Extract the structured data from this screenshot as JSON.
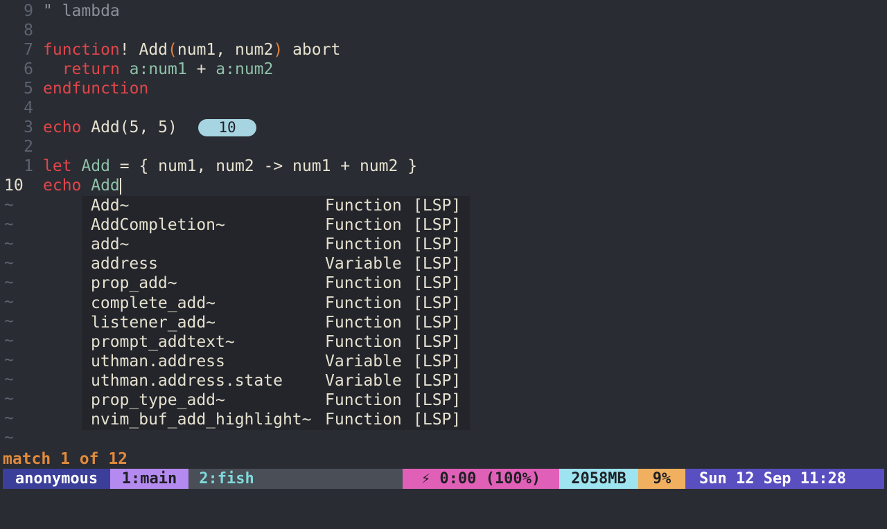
{
  "editor": {
    "lines": [
      {
        "num": "9",
        "tokens": [
          {
            "t": "\" lambda",
            "c": "comment"
          }
        ]
      },
      {
        "num": "8",
        "tokens": []
      },
      {
        "num": "7",
        "tokens": [
          {
            "t": "function",
            "c": "kw"
          },
          {
            "t": "! Add",
            "c": "ident"
          },
          {
            "t": "(",
            "c": "paren"
          },
          {
            "t": "num1, num2",
            "c": "ident"
          },
          {
            "t": ")",
            "c": "paren"
          },
          {
            "t": " abort",
            "c": "ident"
          }
        ]
      },
      {
        "num": "6",
        "tokens": [
          {
            "t": "  ",
            "c": "ident"
          },
          {
            "t": "return",
            "c": "kw"
          },
          {
            "t": " a:num1",
            "c": "var"
          },
          {
            "t": " + ",
            "c": "ident"
          },
          {
            "t": "a:num2",
            "c": "var"
          }
        ]
      },
      {
        "num": "5",
        "tokens": [
          {
            "t": "endfunction",
            "c": "kw"
          }
        ]
      },
      {
        "num": "4",
        "tokens": []
      },
      {
        "num": "3",
        "tokens": [
          {
            "t": "echo",
            "c": "kw"
          },
          {
            "t": " Add(5, 5)",
            "c": "ident"
          }
        ]
      },
      {
        "num": "2",
        "tokens": []
      },
      {
        "num": "1",
        "tokens": [
          {
            "t": "let",
            "c": "kw"
          },
          {
            "t": " Add",
            "c": "var"
          },
          {
            "t": " = { num1, num2 -> num1 + num2 }",
            "c": "ident"
          }
        ]
      },
      {
        "num": "10",
        "tokens": [
          {
            "t": "echo",
            "c": "kw"
          },
          {
            "t": " Add",
            "c": "var"
          }
        ],
        "current": true
      }
    ],
    "virtual_text": "10",
    "tilde": "~"
  },
  "completion": {
    "items": [
      {
        "word": "Add~",
        "kind": "Function",
        "menu": "[LSP]"
      },
      {
        "word": "AddCompletion~",
        "kind": "Function",
        "menu": "[LSP]"
      },
      {
        "word": "add~",
        "kind": "Function",
        "menu": "[LSP]"
      },
      {
        "word": "address",
        "kind": "Variable",
        "menu": "[LSP]"
      },
      {
        "word": "prop_add~",
        "kind": "Function",
        "menu": "[LSP]"
      },
      {
        "word": "complete_add~",
        "kind": "Function",
        "menu": "[LSP]"
      },
      {
        "word": "listener_add~",
        "kind": "Function",
        "menu": "[LSP]"
      },
      {
        "word": "prompt_addtext~",
        "kind": "Function",
        "menu": "[LSP]"
      },
      {
        "word": "uthman.address",
        "kind": "Variable",
        "menu": "[LSP]"
      },
      {
        "word": "uthman.address.state",
        "kind": "Variable",
        "menu": "[LSP]"
      },
      {
        "word": "prop_type_add~",
        "kind": "Function",
        "menu": "[LSP]"
      },
      {
        "word": "nvim_buf_add_highlight~",
        "kind": "Function",
        "menu": "[LSP]"
      }
    ]
  },
  "cmdline": "match 1 of 12",
  "tmux": {
    "session": "anonymous",
    "windows": [
      {
        "label": "1:main",
        "active": true
      },
      {
        "label": "2:fish",
        "active": false
      }
    ],
    "battery": "⚡ 0:00 (100%)",
    "memory": "2058MB",
    "cpu": "9%",
    "datetime": "Sun 12 Sep 11:28",
    "weather_icon": "sun-icon"
  },
  "colors": {
    "background": "#2a2c33",
    "keyword": "#e0464a",
    "badge": "#a6d4e0",
    "session": "#3b3f9a",
    "active_window": "#b58af0",
    "inactive_window": "#7fd9d9",
    "battery": "#e060b8",
    "memory": "#9de4f0",
    "cpu": "#f0b060",
    "datetime": "#5a4fc0"
  }
}
